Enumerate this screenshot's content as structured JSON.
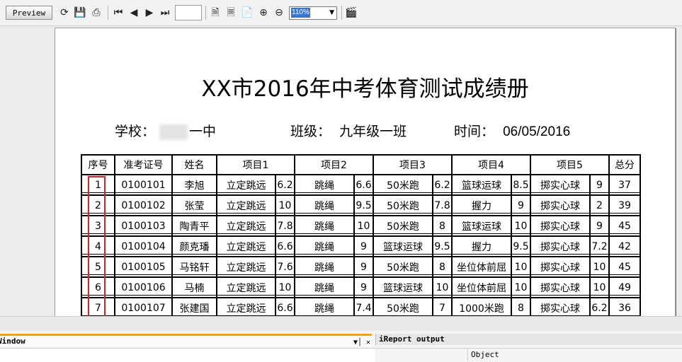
{
  "toolbar": {
    "preview_label": "Preview",
    "zoom_value": "110%",
    "page_value": "",
    "icons": [
      "refresh-icon",
      "save-icon",
      "print-icon",
      "first-page-icon",
      "prev-page-icon",
      "next-page-icon",
      "last-page-icon",
      "single-page-icon",
      "fit-width-icon",
      "fit-page-icon",
      "zoom-in-icon",
      "zoom-out-icon",
      "clapper-icon"
    ]
  },
  "report": {
    "title": "XX市2016年中考体育测试成绩册",
    "school_label": "学校：",
    "school_value": "一中",
    "class_label": "班级：",
    "class_value": "九年级一班",
    "time_label": "时间：",
    "time_value": "06/05/2016"
  },
  "table": {
    "headers": [
      "序号",
      "准考证号",
      "姓名",
      "项目1",
      "项目2",
      "项目3",
      "项目4",
      "项目5",
      "总分"
    ],
    "rows": [
      {
        "no": "1",
        "id": "0100101",
        "name": "李旭",
        "p1": "立定跳远",
        "s1": "6.2",
        "p2": "跳绳",
        "s2": "6.6",
        "p3": "50米跑",
        "s3": "6.2",
        "p4": "篮球运球",
        "s4": "8.5",
        "p5": "掷实心球",
        "s5": "9",
        "total": "37"
      },
      {
        "no": "2",
        "id": "0100102",
        "name": "张莹",
        "p1": "立定跳远",
        "s1": "10",
        "p2": "跳绳",
        "s2": "9.5",
        "p3": "50米跑",
        "s3": "7.8",
        "p4": "握力",
        "s4": "9",
        "p5": "掷实心球",
        "s5": "2",
        "total": "39"
      },
      {
        "no": "3",
        "id": "0100103",
        "name": "陶青平",
        "p1": "立定跳远",
        "s1": "7.8",
        "p2": "跳绳",
        "s2": "10",
        "p3": "50米跑",
        "s3": "8",
        "p4": "篮球运球",
        "s4": "10",
        "p5": "掷实心球",
        "s5": "9",
        "total": "45"
      },
      {
        "no": "4",
        "id": "0100104",
        "name": "颜克璠",
        "p1": "立定跳远",
        "s1": "6.6",
        "p2": "跳绳",
        "s2": "9",
        "p3": "篮球运球",
        "s3": "9.5",
        "p4": "握力",
        "s4": "9.5",
        "p5": "掷实心球",
        "s5": "7.2",
        "total": "42"
      },
      {
        "no": "5",
        "id": "0100105",
        "name": "马铭轩",
        "p1": "立定跳远",
        "s1": "7.6",
        "p2": "跳绳",
        "s2": "9",
        "p3": "50米跑",
        "s3": "8",
        "p4": "坐位体前屈",
        "s4": "10",
        "p5": "掷实心球",
        "s5": "10",
        "total": "45"
      },
      {
        "no": "6",
        "id": "0100106",
        "name": "马楠",
        "p1": "立定跳远",
        "s1": "10",
        "p2": "跳绳",
        "s2": "9",
        "p3": "篮球运球",
        "s3": "10",
        "p4": "坐位体前屈",
        "s4": "10",
        "p5": "掷实心球",
        "s5": "10",
        "total": "49"
      },
      {
        "no": "7",
        "id": "0100107",
        "name": "张建国",
        "p1": "立定跳远",
        "s1": "6.6",
        "p2": "跳绳",
        "s2": "7.4",
        "p3": "50米跑",
        "s3": "7",
        "p4": "1000米跑",
        "s4": "8",
        "p5": "掷实心球",
        "s5": "6.2",
        "total": "36"
      }
    ]
  },
  "bottom": {
    "left_tab": "Window",
    "right_tab": "iReport output",
    "object_label": "Object"
  },
  "colors": {
    "highlight_box": "#e02020",
    "panel_accent": "#f4a300",
    "zoom_selection": "#3874d8"
  }
}
